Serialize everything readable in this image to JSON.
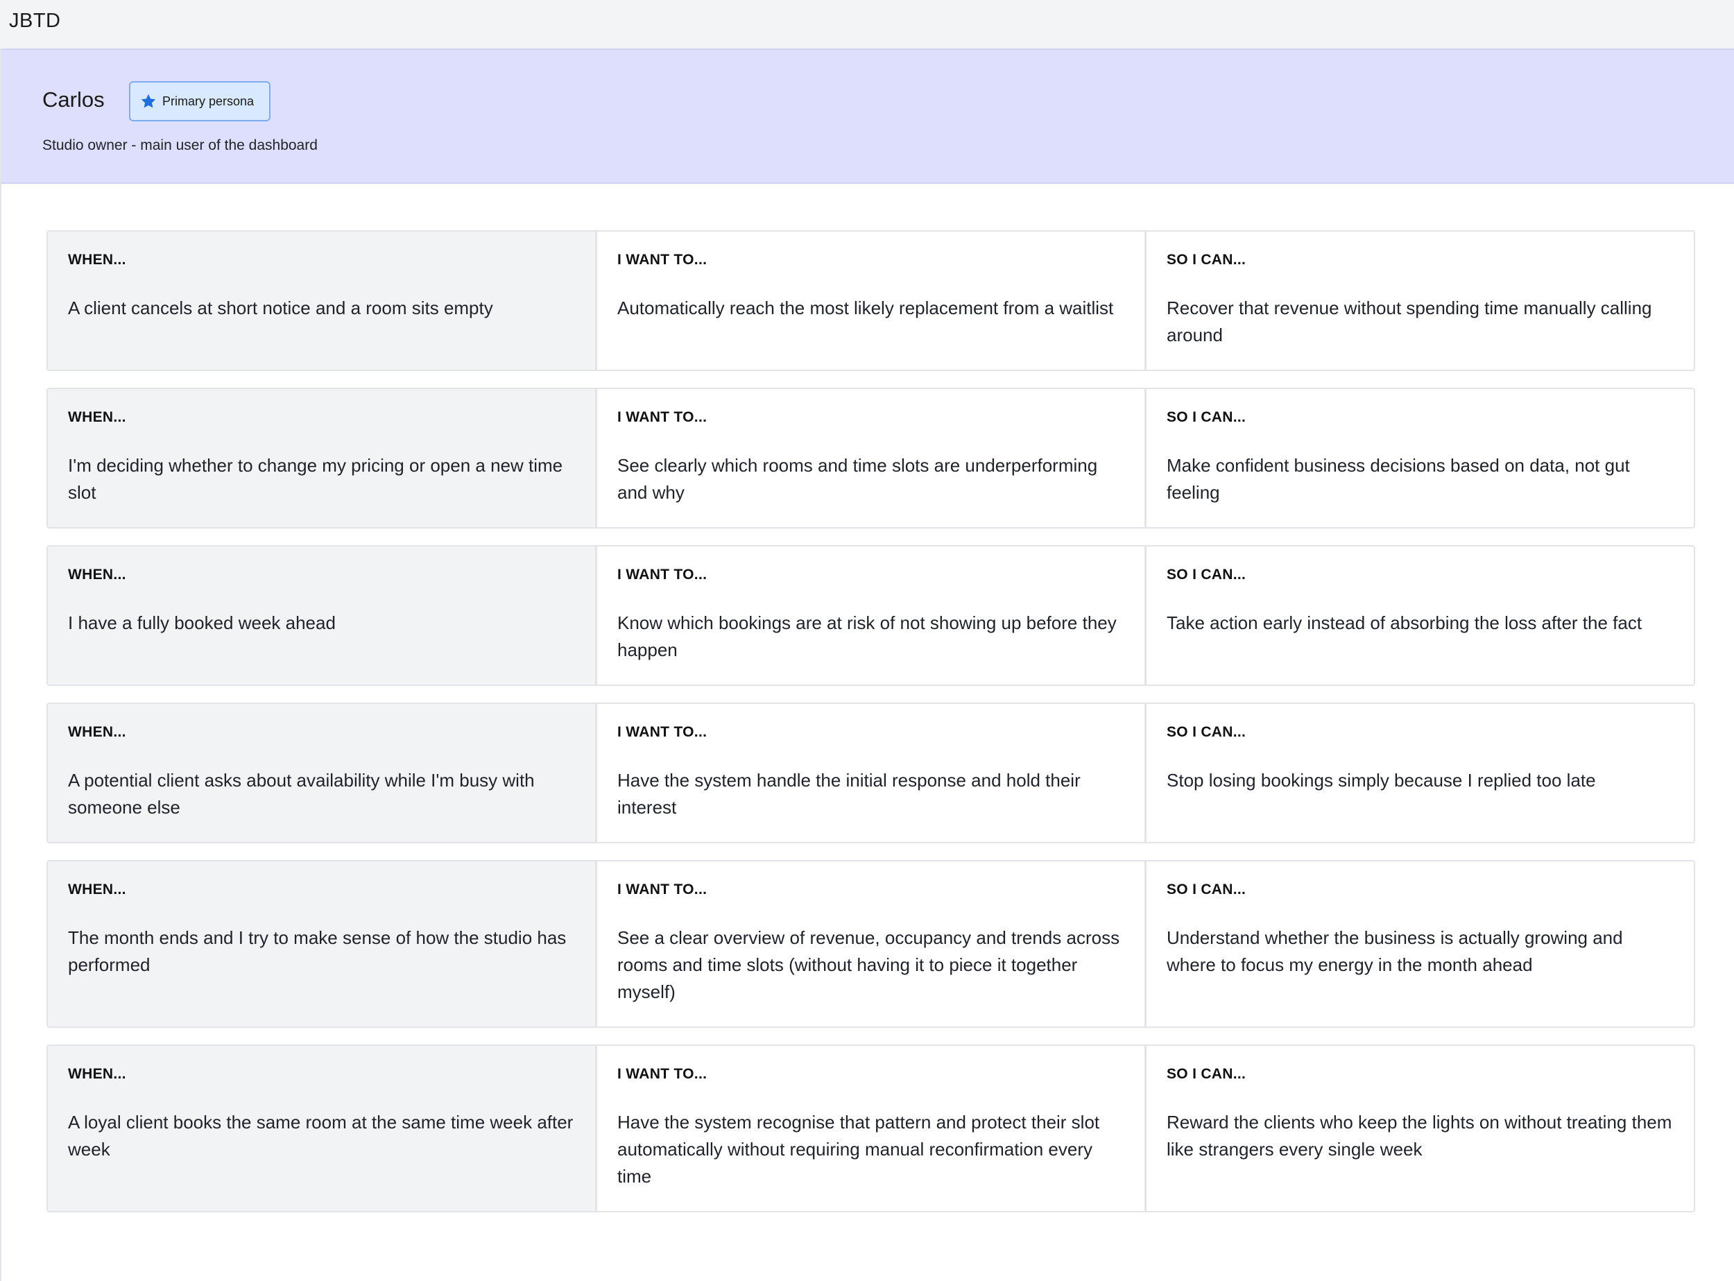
{
  "app": {
    "title": "JBTD"
  },
  "persona": {
    "name": "Carlos",
    "badge_label": "Primary persona",
    "badge_icon": "star-icon",
    "badge_color": "#1f6fe0",
    "description": "Studio owner - main user of the dashboard"
  },
  "labels": {
    "when": "WHEN...",
    "want": "I WANT TO...",
    "so": "SO I CAN..."
  },
  "stories": [
    {
      "when": "A client cancels at short notice and a room sits empty",
      "want": "Automatically reach the most likely replacement from a waitlist",
      "so": "Recover that revenue without spending time manually calling around"
    },
    {
      "when": "I'm deciding whether to change my pricing or open a new time slot",
      "want": "See clearly which rooms and time slots are underperforming and why",
      "so": "Make confident business decisions based on data, not gut feeling"
    },
    {
      "when": "I have a fully booked week ahead",
      "want": "Know which bookings are at risk of not showing up before they happen",
      "so": "Take action early instead of absorbing the loss after the fact"
    },
    {
      "when": "A potential client asks about availability while I'm busy with someone else",
      "want": "Have the system handle the initial response and hold their interest",
      "so": "Stop losing bookings simply because I replied too late"
    },
    {
      "when": "The month ends and I try to make sense of how the studio has performed",
      "want": "See a clear overview of revenue, occupancy and trends across rooms and time slots (without having it to piece it together myself)",
      "so": "Understand whether the business is actually growing and where to focus my energy in the month ahead"
    },
    {
      "when": "A loyal client books the same room at the same time week after week",
      "want": "Have the system recognise that pattern and protect their slot automatically without requiring manual reconfirmation every time",
      "so": "Reward the clients who keep the lights on without treating them like strangers every single week"
    }
  ]
}
